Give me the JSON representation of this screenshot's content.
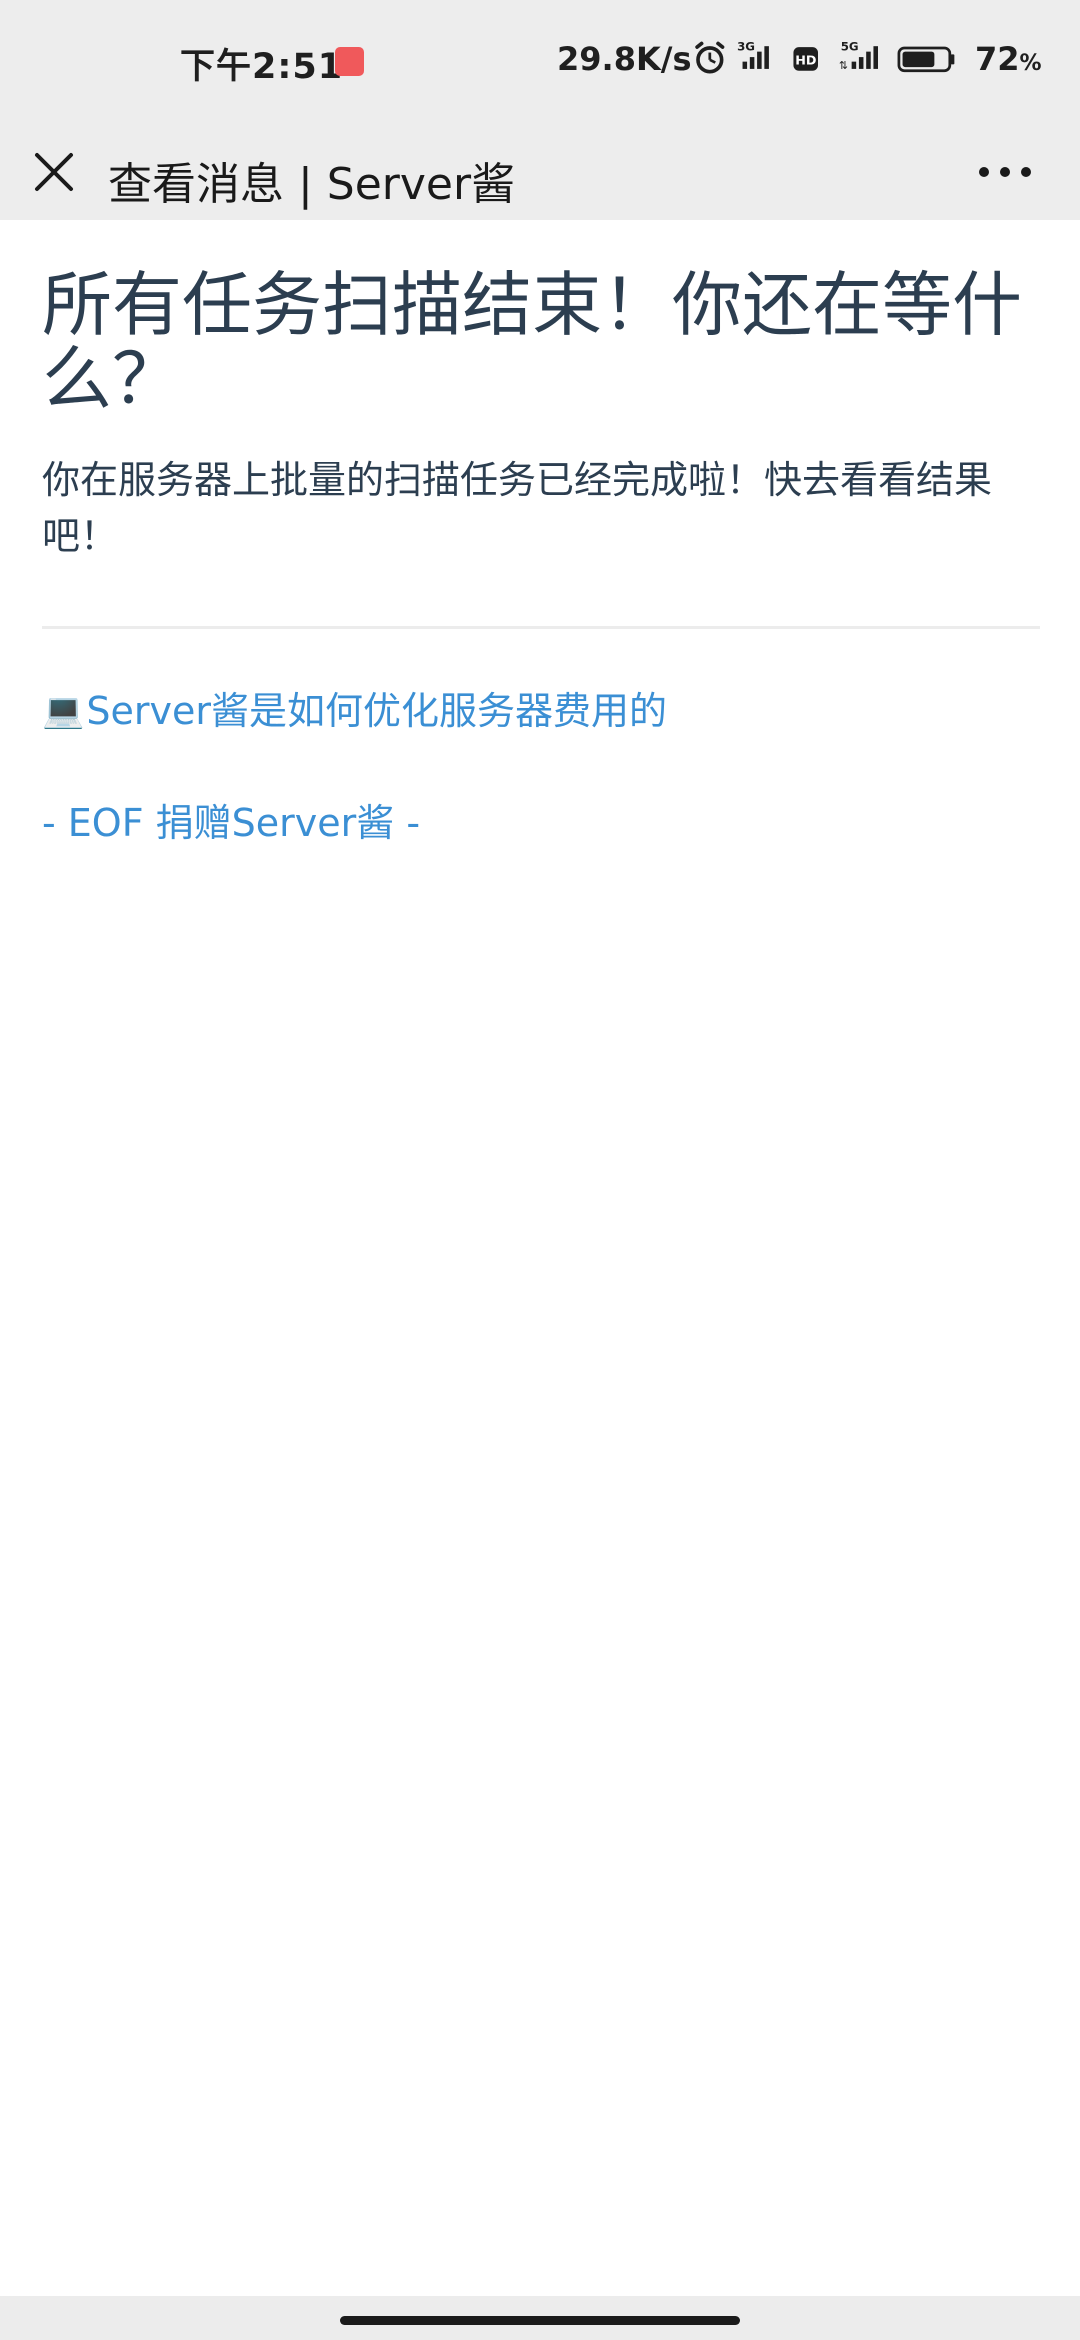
{
  "status_bar": {
    "time": "下午2:51",
    "network_speed": "29.8K/s",
    "signal_1_label": "3G",
    "signal_2_label": "5G",
    "hd_label": "HD",
    "battery_value": "72",
    "battery_unit": "%",
    "battery_level": 0.72,
    "app_icon_color": "#f0595b"
  },
  "title_bar": {
    "title": "查看消息 | Server酱",
    "close_icon": "close-icon",
    "more_icon": "more-horizontal-icon"
  },
  "content": {
    "headline": "所有任务扫描结束！你还在等什么？",
    "body": "你在服务器上批量的扫描任务已经完成啦！快去看看结果吧！",
    "link_icon": "💻",
    "link_text": "Server酱是如何优化服务器费用的",
    "eof_prefix": "- EOF ",
    "eof_link": "捐赠Server酱",
    "eof_suffix": " -"
  },
  "colors": {
    "text_dark": "#2c3e50",
    "link": "#3b8fd4",
    "bar_bg": "#ededed"
  }
}
